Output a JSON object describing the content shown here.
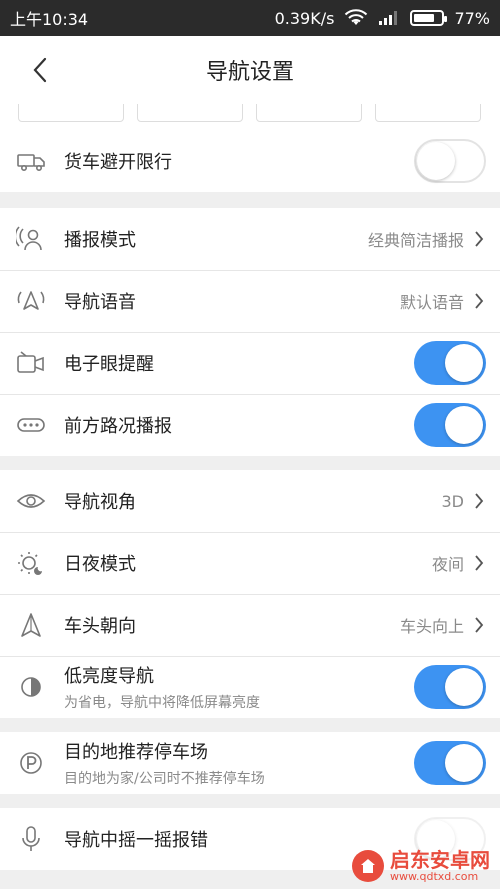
{
  "status_bar": {
    "time": "上午10:34",
    "speed": "0.39K/s",
    "battery": "77%",
    "battery_level": 0.77
  },
  "nav": {
    "title": "导航设置"
  },
  "groups": {
    "truck": {
      "label": "货车避开限行",
      "toggle": "off"
    },
    "voice": {
      "broadcast_mode": {
        "label": "播报模式",
        "value": "经典简洁播报"
      },
      "nav_voice": {
        "label": "导航语音",
        "value": "默认语音"
      },
      "camera_alert": {
        "label": "电子眼提醒",
        "toggle": "on"
      },
      "traffic_ahead": {
        "label": "前方路况播报",
        "toggle": "on"
      }
    },
    "display": {
      "view_angle": {
        "label": "导航视角",
        "value": "3D"
      },
      "day_night": {
        "label": "日夜模式",
        "value": "夜间"
      },
      "heading": {
        "label": "车头朝向",
        "value": "车头向上"
      },
      "low_brightness": {
        "label": "低亮度导航",
        "sub": "为省电，导航中将降低屏幕亮度",
        "toggle": "on"
      }
    },
    "parking": {
      "label": "目的地推荐停车场",
      "sub": "目的地为家/公司时不推荐停车场",
      "toggle": "on"
    },
    "shake": {
      "label": "导航中摇一摇报错",
      "toggle": "off"
    }
  },
  "watermark": {
    "cn": "启东安卓网",
    "en": "www.qdtxd.com"
  },
  "colors": {
    "accent": "#3d93f2",
    "status_bar": "#2b2b2b",
    "background": "#efefef"
  }
}
